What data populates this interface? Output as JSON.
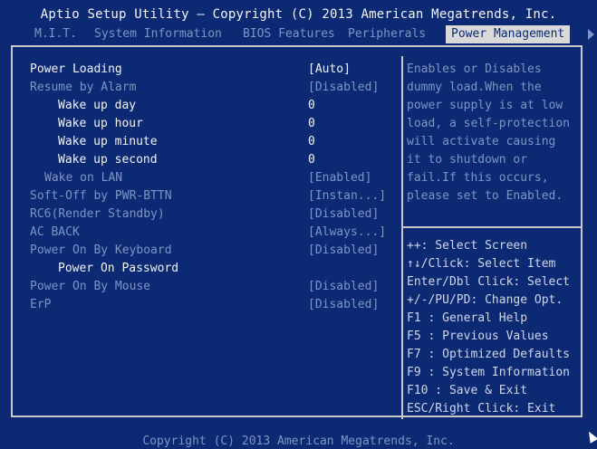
{
  "header": {
    "title": "Aptio Setup Utility – Copyright (C) 2013 American Megatrends, Inc.",
    "tabs": [
      {
        "label": "M.I.T."
      },
      {
        "label": "System Information"
      },
      {
        "label": "BIOS Features"
      },
      {
        "label": "Peripherals"
      },
      {
        "label": "Power Management"
      }
    ]
  },
  "settings": [
    {
      "label": "Power Loading",
      "value": "[Auto]"
    },
    {
      "label": "Resume by Alarm",
      "value": "[Disabled]"
    },
    {
      "label": "Wake up day",
      "value": "0"
    },
    {
      "label": "Wake up hour",
      "value": "0"
    },
    {
      "label": "Wake up minute",
      "value": "0"
    },
    {
      "label": "Wake up second",
      "value": "0"
    },
    {
      "label": "Wake on LAN",
      "value": "[Enabled]"
    },
    {
      "label": "Soft-Off by PWR-BTTN",
      "value": "[Instan...]"
    },
    {
      "label": "RC6(Render Standby)",
      "value": "[Disabled]"
    },
    {
      "label": "AC BACK",
      "value": "[Always...]"
    },
    {
      "label": "Power On By Keyboard",
      "value": "[Disabled]"
    },
    {
      "label": "Power On Password",
      "value": ""
    },
    {
      "label": "Power On By Mouse",
      "value": "[Disabled]"
    },
    {
      "label": "ErP",
      "value": "[Disabled]"
    }
  ],
  "help": {
    "lines": [
      "Enables or Disables",
      "dummy load.When the",
      "power supply is at low",
      "load, a self-protection",
      "will activate causing",
      "it to shutdown or",
      "fail.If this occurs,",
      "please set to Enabled."
    ]
  },
  "keys": {
    "lines": [
      "++: Select Screen",
      "↑↓/Click: Select Item",
      "Enter/Dbl Click: Select",
      "+/-/PU/PD: Change Opt.",
      "F1  : General Help",
      "F5  : Previous Values",
      "F7  : Optimized Defaults",
      "F9  : System Information",
      "F10 : Save & Exit",
      "ESC/Right Click: Exit"
    ]
  },
  "footer": {
    "text": "Copyright (C) 2013 American Megatrends, Inc."
  },
  "colors": {
    "background": "#0c2a73",
    "inactive_text": "#7e94c4",
    "active_tab_bg": "#d9d9d9"
  }
}
